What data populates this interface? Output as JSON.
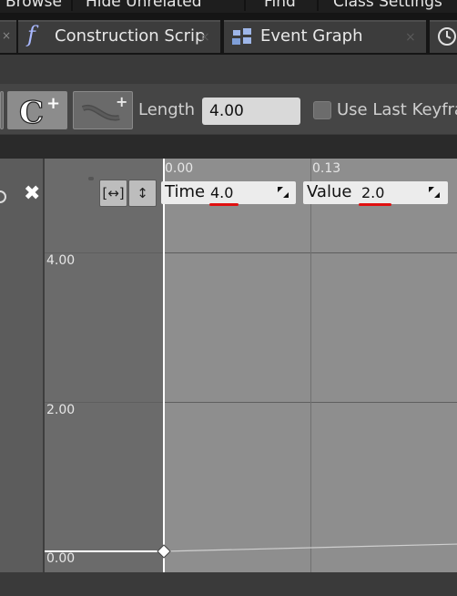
{
  "top_menu": {
    "browse": "Browse",
    "hide_unrelated": "Hide Unrelated",
    "find": "Find",
    "class_settings": "Class Settings"
  },
  "tabs": [
    {
      "label": "Construction Scrip",
      "icon": "function-icon",
      "close": "×"
    },
    {
      "label": "Event Graph",
      "icon": "event-graph-icon",
      "close": "×"
    }
  ],
  "toolbar": {
    "length_label": "Length",
    "length_value": "4.00",
    "use_last_keyframe_label": "Use Last Keyfran",
    "use_last_keyframe_checked": false
  },
  "graph": {
    "y_labels": [
      "4.00",
      "2.00",
      "0.00"
    ],
    "x_labels": [
      "0.00",
      "0.13"
    ],
    "time_label": "Time",
    "time_value": "4.0",
    "value_label": "Value",
    "value_value": "2.0",
    "zoom_horizontal": "[↔]",
    "zoom_vertical": "↕"
  },
  "colors": {
    "annotation_underline": "#e01010",
    "graph_bg": "#8e8e8e",
    "field_bg": "#ececec"
  }
}
